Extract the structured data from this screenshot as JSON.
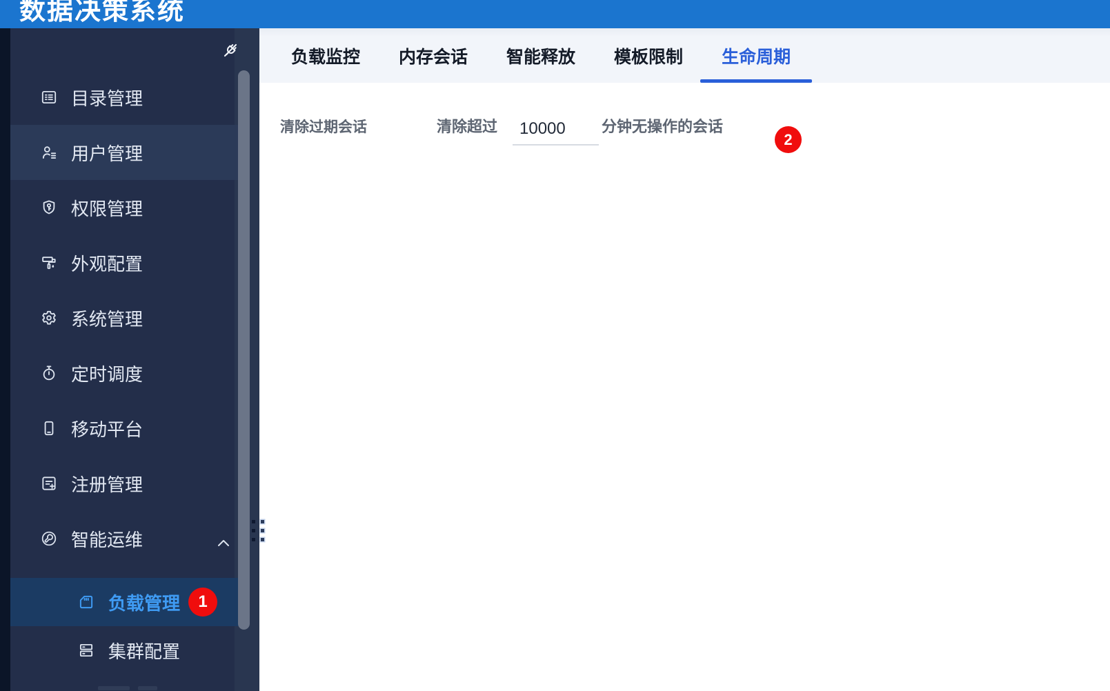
{
  "app": {
    "title": "数据决策系统"
  },
  "sidebar": {
    "items": [
      {
        "label": "目录管理",
        "icon": "catalog-icon"
      },
      {
        "label": "用户管理",
        "icon": "users-icon",
        "state": "hover"
      },
      {
        "label": "权限管理",
        "icon": "permission-icon"
      },
      {
        "label": "外观配置",
        "icon": "appearance-icon"
      },
      {
        "label": "系统管理",
        "icon": "system-icon"
      },
      {
        "label": "定时调度",
        "icon": "schedule-icon"
      },
      {
        "label": "移动平台",
        "icon": "mobile-icon"
      },
      {
        "label": "注册管理",
        "icon": "register-icon"
      },
      {
        "label": "智能运维",
        "icon": "ops-icon",
        "expanded": true
      }
    ],
    "subitems": [
      {
        "label": "负载管理",
        "icon": "load-icon",
        "selected": true,
        "badge": "1"
      },
      {
        "label": "集群配置",
        "icon": "cluster-icon"
      }
    ]
  },
  "tabs": {
    "items": [
      {
        "label": "负载监控"
      },
      {
        "label": "内存会话"
      },
      {
        "label": "智能释放"
      },
      {
        "label": "模板限制"
      },
      {
        "label": "生命周期",
        "active": true
      }
    ]
  },
  "content": {
    "section_label": "清除过期会话",
    "input_prefix_label": "清除超过",
    "timeout_input": {
      "value": "10000"
    },
    "input_suffix_label": "分钟无操作的会话",
    "step_badge": "2"
  },
  "colors": {
    "topbar_blue": "#1b75cf",
    "sidebar_bg": "#232e4a",
    "sidebar_selected_text": "#3f9bf3",
    "tab_active_blue": "#2a5fd9",
    "badge_red": "#f00d0d"
  }
}
